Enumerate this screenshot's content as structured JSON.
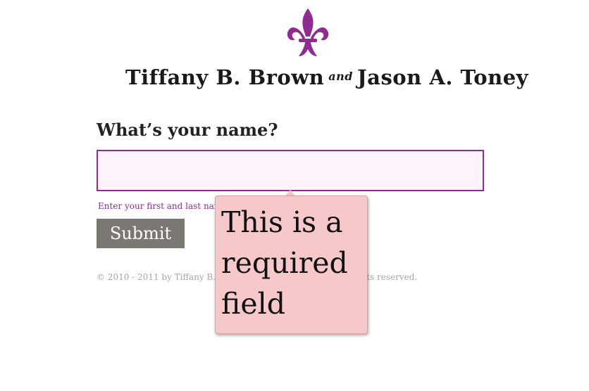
{
  "header": {
    "logo_icon": "fleur-de-lis-icon",
    "bride_name": "Tiffany B. Brown",
    "and_word": "and",
    "groom_name": "Jason A. Toney"
  },
  "form": {
    "question": "What’s your name?",
    "name_value": "",
    "hint": "Enter your first and last name, including any titles or suffixes.",
    "submit_label": "Submit"
  },
  "validation": {
    "message": "This is a required field"
  },
  "footer": {
    "copyright": "© 2010 - 2011 by Tiffany B. Brown and Jason A. Toney. All rights reserved."
  },
  "colors": {
    "accent": "#8e2c92",
    "input_bg": "#fdf3fc",
    "button_bg": "#7b7772",
    "tooltip_bg": "#f6c8c9",
    "muted_text": "#a9a5a1"
  }
}
